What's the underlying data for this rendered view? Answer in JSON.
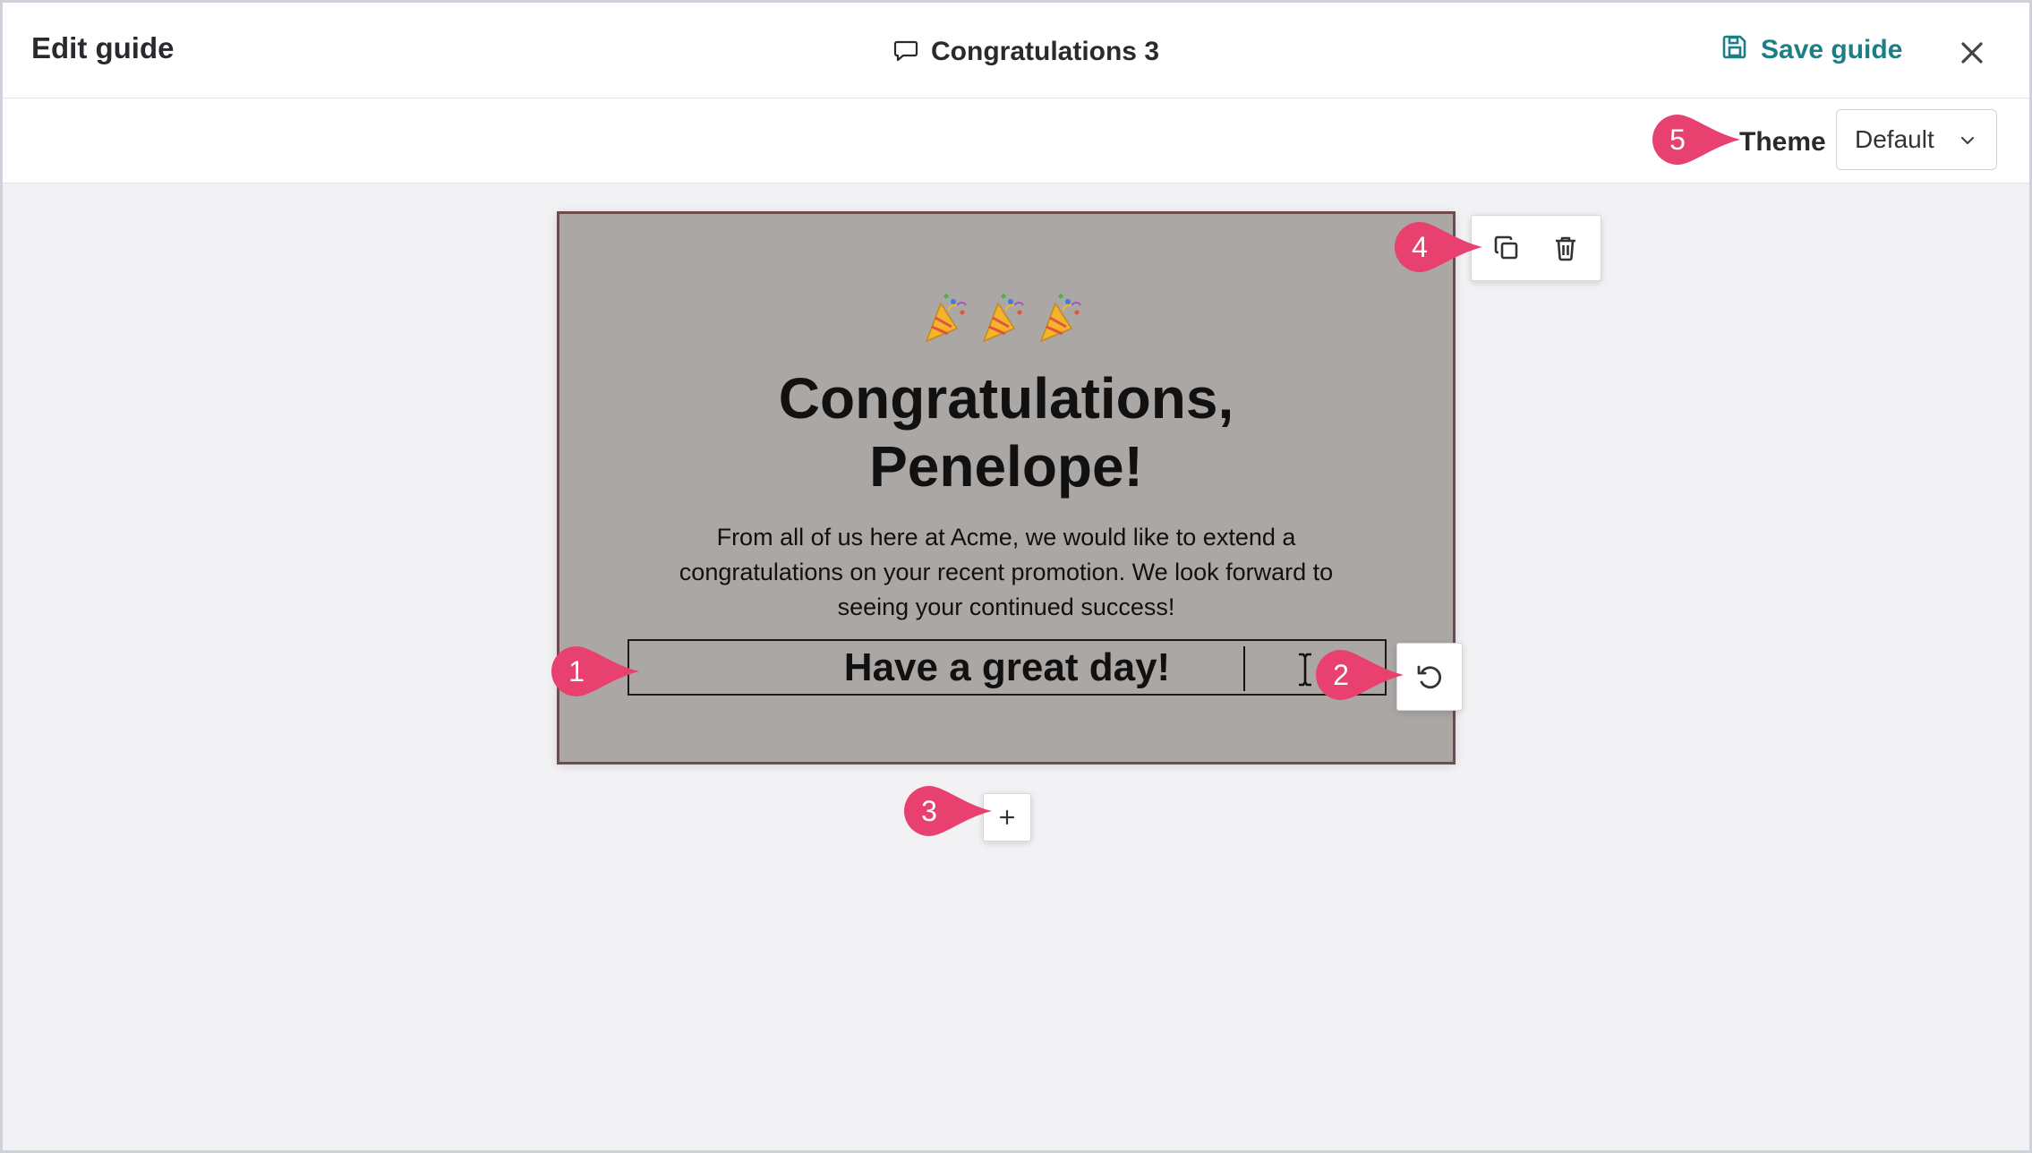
{
  "header": {
    "title": "Edit guide",
    "guide_name": "Congratulations 3",
    "guide_icon": "message-icon",
    "save_label": "Save guide",
    "save_icon": "save-icon",
    "close_icon": "close-icon"
  },
  "toolbar": {
    "theme_label": "Theme",
    "theme_value": "Default"
  },
  "card": {
    "emoji": "party-popper",
    "headline_line1": "Congratulations,",
    "headline_line2": "Penelope!",
    "body": "From all of us here at Acme, we would like to extend a congratulations on your recent promotion. We look forward to seeing your continued success!",
    "editing_text": "Have a great day!"
  },
  "markers": [
    "1",
    "2",
    "3",
    "4",
    "5"
  ],
  "colors": {
    "accent": "#1d7f86",
    "marker": "#e8416f",
    "card_background": "#aba7a5",
    "card_border": "#6e4b4d"
  }
}
